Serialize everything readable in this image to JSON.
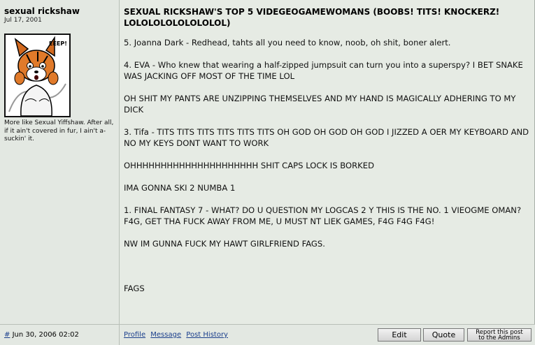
{
  "user": {
    "name": "sexual rickshaw",
    "join_date": "Jul 17, 2001",
    "avatar_caption": "EEEP!",
    "title_text": "More like Sexual Yiffshaw. After all, if it ain't covered in fur, I ain't a-suckin' it."
  },
  "post": {
    "title": "SEXUAL RICKSHAW'S TOP 5 VIDEGEOGAMEWOMANS (BOOBS! TITS! KNOCKERZ! LOLOLOLOLOLOLOLOL)",
    "paragraphs": [
      "5. Joanna Dark - Redhead, tahts all you need to know, noob, oh shit, boner alert.",
      "4. EVA - Who knew that wearing a half-zipped jumpsuit can turn you into a superspy? I BET SNAKE WAS JACKING OFF MOST OF THE TIME LOL",
      "OH SHIT MY PANTS ARE UNZIPPING THEMSELVES AND MY HAND IS MAGICALLY ADHERING TO MY DICK",
      "3. Tifa - TITS TITS TITS TITS TITS TITS OH GOD OH GOD OH GOD I JIZZED A OER MY KEYBOARD AND NO MY KEYS DONT WANT TO WORK",
      "OHHHHHHHHHHHHHHHHHHHHH SHIT CAPS LOCK IS BORKED",
      "IMA GONNA SKI 2 NUMBA 1",
      "1. FINAL FANTASY 7 - WHAT? DO U QUESTION MY LOGCAS 2 Y THIS IS THE NO. 1 VIEOGME OMAN? F4G, GET THA FUCK AWAY FROM ME, U MUST NT LIEK GAMES, F4G F4G F4G!",
      "NW IM GUNNA FUCK MY HAWT GIRLFRIEND FAGS."
    ],
    "closing": "FAGS"
  },
  "footer": {
    "permalink_symbol": "#",
    "date": "Jun 30, 2006 02:02",
    "profile": "Profile",
    "message": "Message",
    "post_history": "Post History",
    "edit": "Edit",
    "quote": "Quote",
    "report_line1": "Report this post",
    "report_line2": "to the Admins"
  }
}
